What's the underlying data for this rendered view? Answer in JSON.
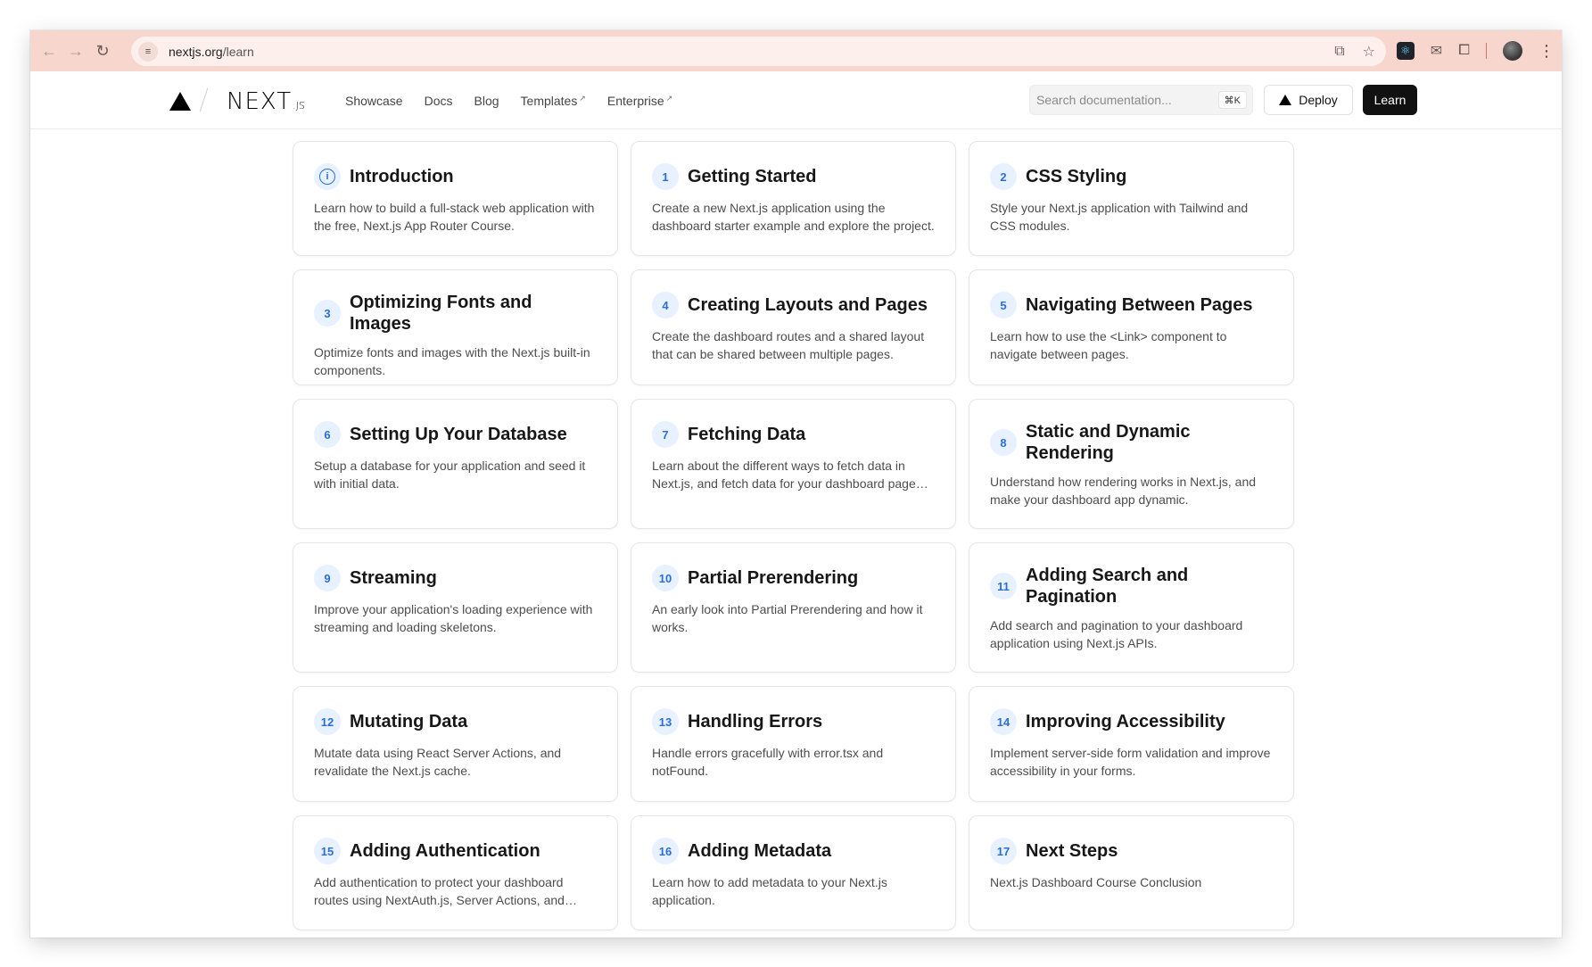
{
  "browser": {
    "url_host": "nextjs.org",
    "url_path": "/learn",
    "back_icon": "arrow-left-icon",
    "forward_icon": "arrow-right-icon",
    "reload_icon": "reload-icon"
  },
  "header": {
    "logo_text": "NEXT",
    "logo_suffix": ".JS",
    "nav": [
      {
        "label": "Showcase",
        "external": false
      },
      {
        "label": "Docs",
        "external": false
      },
      {
        "label": "Blog",
        "external": false
      },
      {
        "label": "Templates",
        "external": true
      },
      {
        "label": "Enterprise",
        "external": true
      }
    ],
    "search_placeholder": "Search documentation...",
    "search_shortcut": "⌘K",
    "deploy_label": "Deploy",
    "learn_label": "Learn"
  },
  "chapters": [
    {
      "badge": "",
      "icon": "info-icon",
      "title": "Introduction",
      "desc": "Learn how to build a full-stack web application with the free, Next.js App Router Course."
    },
    {
      "badge": "1",
      "title": "Getting Started",
      "desc": "Create a new Next.js application using the dashboard starter example and explore the project."
    },
    {
      "badge": "2",
      "title": "CSS Styling",
      "desc": "Style your Next.js application with Tailwind and CSS modules."
    },
    {
      "badge": "3",
      "title": "Optimizing Fonts and Images",
      "desc": "Optimize fonts and images with the Next.js built-in components."
    },
    {
      "badge": "4",
      "title": "Creating Layouts and Pages",
      "desc": "Create the dashboard routes and a shared layout that can be shared between multiple pages."
    },
    {
      "badge": "5",
      "title": "Navigating Between Pages",
      "desc": "Learn how to use the <Link> component to navigate between pages."
    },
    {
      "badge": "6",
      "title": "Setting Up Your Database",
      "desc": "Setup a database for your application and seed it with initial data."
    },
    {
      "badge": "7",
      "title": "Fetching Data",
      "desc": "Learn about the different ways to fetch data in Next.js, and fetch data for your dashboard page using Server Components."
    },
    {
      "badge": "8",
      "title": "Static and Dynamic Rendering",
      "desc": "Understand how rendering works in Next.js, and make your dashboard app dynamic."
    },
    {
      "badge": "9",
      "title": "Streaming",
      "desc": "Improve your application's loading experience with streaming and loading skeletons."
    },
    {
      "badge": "10",
      "title": "Partial Prerendering",
      "desc": "An early look into Partial Prerendering and how it works."
    },
    {
      "badge": "11",
      "title": "Adding Search and Pagination",
      "desc": "Add search and pagination to your dashboard application using Next.js APIs."
    },
    {
      "badge": "12",
      "title": "Mutating Data",
      "desc": "Mutate data using React Server Actions, and revalidate the Next.js cache."
    },
    {
      "badge": "13",
      "title": "Handling Errors",
      "desc": "Handle errors gracefully with error.tsx and notFound."
    },
    {
      "badge": "14",
      "title": "Improving Accessibility",
      "desc": "Implement server-side form validation and improve accessibility in your forms."
    },
    {
      "badge": "15",
      "title": "Adding Authentication",
      "desc": "Add authentication to protect your dashboard routes using NextAuth.js, Server Actions, and Middleware."
    },
    {
      "badge": "16",
      "title": "Adding Metadata",
      "desc": "Learn how to add metadata to your Next.js application."
    },
    {
      "badge": "17",
      "title": "Next Steps",
      "desc": "Next.js Dashboard Course Conclusion"
    }
  ],
  "colors": {
    "chrome_bg": "#f6d6cd",
    "badge_bg": "#e8f1ff",
    "badge_text": "#2b6fd6",
    "learn_button_bg": "#111111"
  }
}
